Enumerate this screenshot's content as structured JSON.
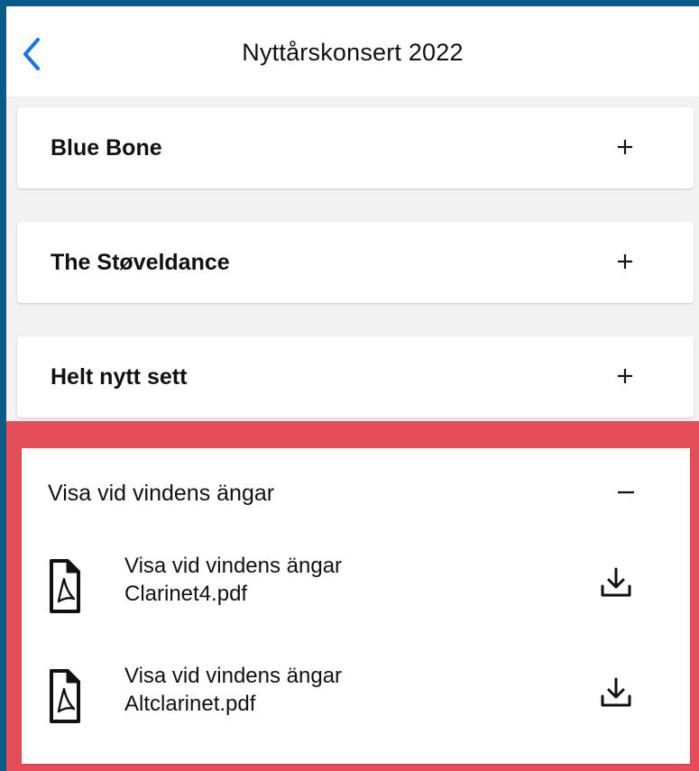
{
  "header": {
    "title": "Nyttårskonsert 2022",
    "back_icon": "chevron-left-icon",
    "accent": "#1a73e8"
  },
  "sections": [
    {
      "title": "Blue Bone",
      "state": "collapsed",
      "toggle": "+"
    },
    {
      "title": "The Støveldance",
      "state": "collapsed",
      "toggle": "+"
    },
    {
      "title": "Helt nytt sett",
      "state": "collapsed",
      "toggle": "+"
    }
  ],
  "expanded": {
    "title": "Visa vid vindens ängar",
    "toggle": "−",
    "highlight_color": "#e54d59",
    "files": [
      {
        "line1": "Visa vid vindens ängar",
        "line2": "Clarinet4.pdf",
        "icon": "pdf-file-icon",
        "action_icon": "download-icon"
      },
      {
        "line1": "Visa vid vindens ängar",
        "line2": "Altclarinet.pdf",
        "icon": "pdf-file-icon",
        "action_icon": "download-icon"
      }
    ]
  }
}
